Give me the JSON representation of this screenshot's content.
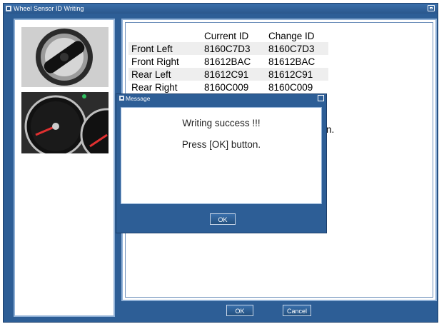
{
  "window": {
    "title": "Wheel Sensor ID Writing"
  },
  "table": {
    "headers": [
      "",
      "Current ID",
      "Change ID"
    ],
    "rows": [
      {
        "position": "Front Left",
        "current": "8160C7D3",
        "change": "8160C7D3"
      },
      {
        "position": "Front Right",
        "current": "81612BAC",
        "change": "81612BAC"
      },
      {
        "position": "Rear Left",
        "current": "81612C91",
        "change": "81612C91"
      },
      {
        "position": "Rear Right",
        "current": "8160C009",
        "change": "8160C009"
      }
    ]
  },
  "background_text": "n.",
  "buttons": {
    "ok": "OK",
    "cancel": "Cancel"
  },
  "dialog": {
    "title": "Message",
    "line1": "Writing success !!!",
    "line2": "Press [OK] button.",
    "ok": "OK"
  },
  "colors": {
    "frame": "#2d5e96",
    "panel_border": "#8fb0d6",
    "row_highlight": "#eeeeee"
  }
}
